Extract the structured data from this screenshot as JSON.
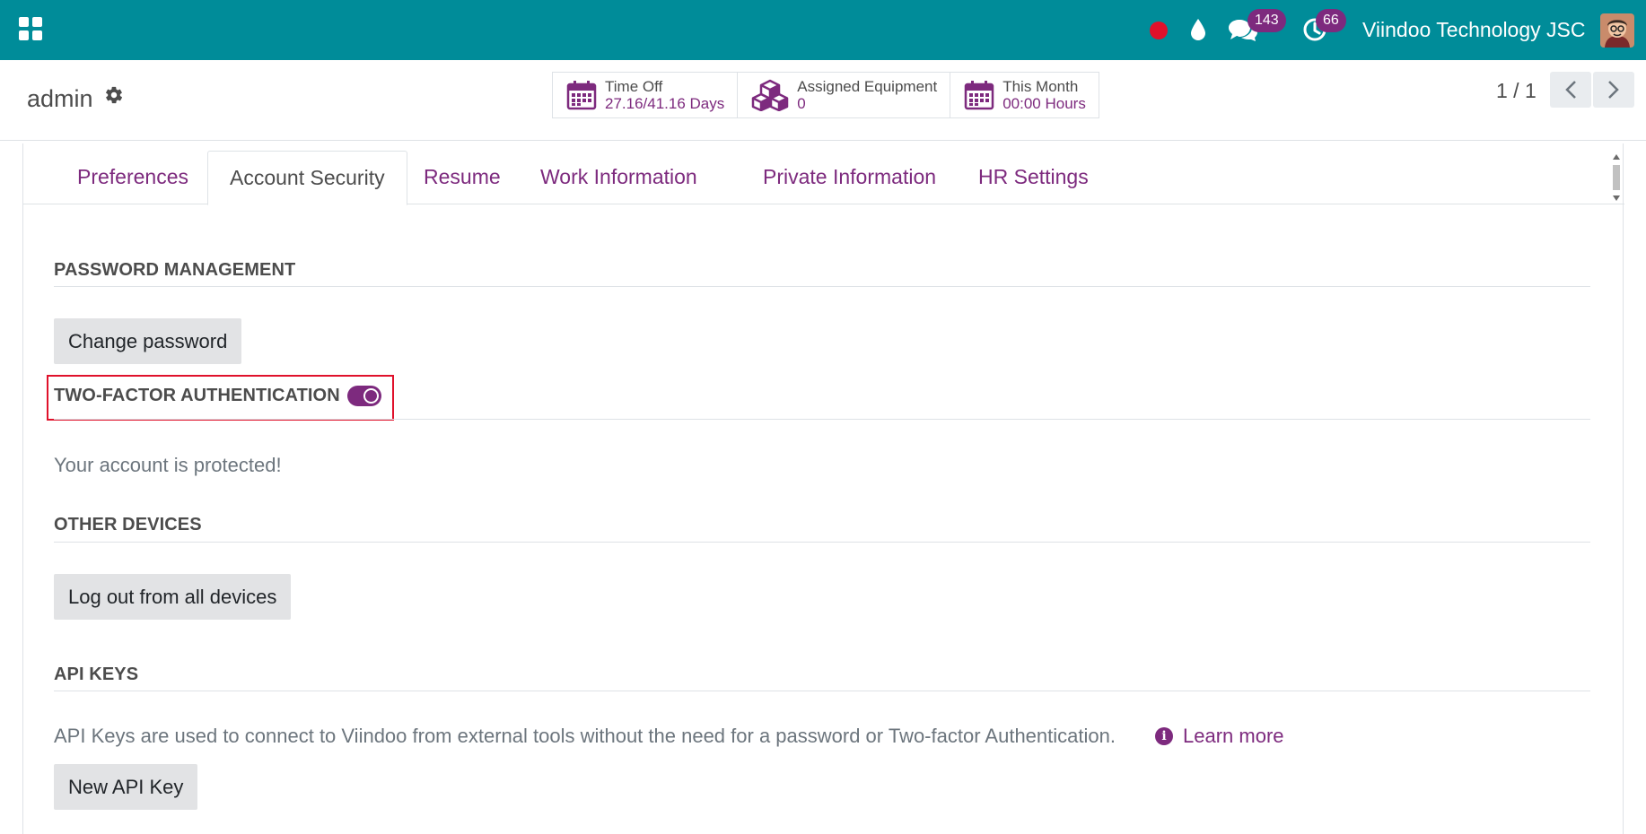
{
  "navbar": {
    "apps_icon": "grid-icon",
    "record_icon": "record-dot-icon",
    "drop_icon": "drop-icon",
    "chat_icon": "chat-icon",
    "chat_count": "143",
    "activity_icon": "clock-icon",
    "activity_count": "66",
    "company": "Viindoo Technology JSC",
    "avatar_icon": "user-avatar-icon"
  },
  "control_panel": {
    "title": "admin",
    "gear_icon": "gear-icon",
    "stat_buttons": [
      {
        "label": "Time Off",
        "value": "27.16/41.16 Days",
        "icon": "calendar-icon"
      },
      {
        "label": "Assigned Equipment",
        "value": "0",
        "icon": "cubes-icon"
      },
      {
        "label": "This Month",
        "value": "00:00 Hours",
        "icon": "calendar-icon"
      }
    ],
    "pager": {
      "value": "1 / 1",
      "prev_icon": "chevron-left-icon",
      "next_icon": "chevron-right-icon"
    }
  },
  "tabs": [
    {
      "label": "Preferences",
      "active": false
    },
    {
      "label": "Account Security",
      "active": true
    },
    {
      "label": "Resume",
      "active": false
    },
    {
      "label": "Work Information",
      "active": false
    },
    {
      "label": "Private Information",
      "active": false
    },
    {
      "label": "HR Settings",
      "active": false
    }
  ],
  "security": {
    "password_title": "PASSWORD MANAGEMENT",
    "change_password": "Change password",
    "tfa_title": "TWO-FACTOR AUTHENTICATION",
    "tfa_enabled": true,
    "tfa_status": "Your account is protected!",
    "devices_title": "OTHER DEVICES",
    "logout_all": "Log out from all devices",
    "api_title": "API KEYS",
    "api_description": "API Keys are used to connect to Viindoo from external tools without the need for a password or Two-factor Authentication.",
    "info_icon": "info-icon",
    "learn_more": "Learn more",
    "new_api_key": "New API Key"
  },
  "colors": {
    "navbar": "#008c99",
    "accent": "#7d2a7e",
    "highlight": "#e0112b",
    "record": "#e0112b"
  }
}
